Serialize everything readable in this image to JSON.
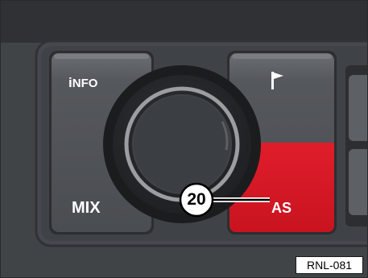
{
  "buttons": {
    "info": {
      "label_prefix": "i",
      "label_rest": "NFO"
    },
    "mix": {
      "label": "MIX"
    },
    "as": {
      "label": "AS",
      "highlight_color": "#d51a27"
    },
    "flag": {
      "icon": "flag-icon"
    }
  },
  "knob": {
    "icon": "rotary-knob"
  },
  "callout": {
    "number": "20"
  },
  "figure": {
    "reference": "RNL-081"
  }
}
